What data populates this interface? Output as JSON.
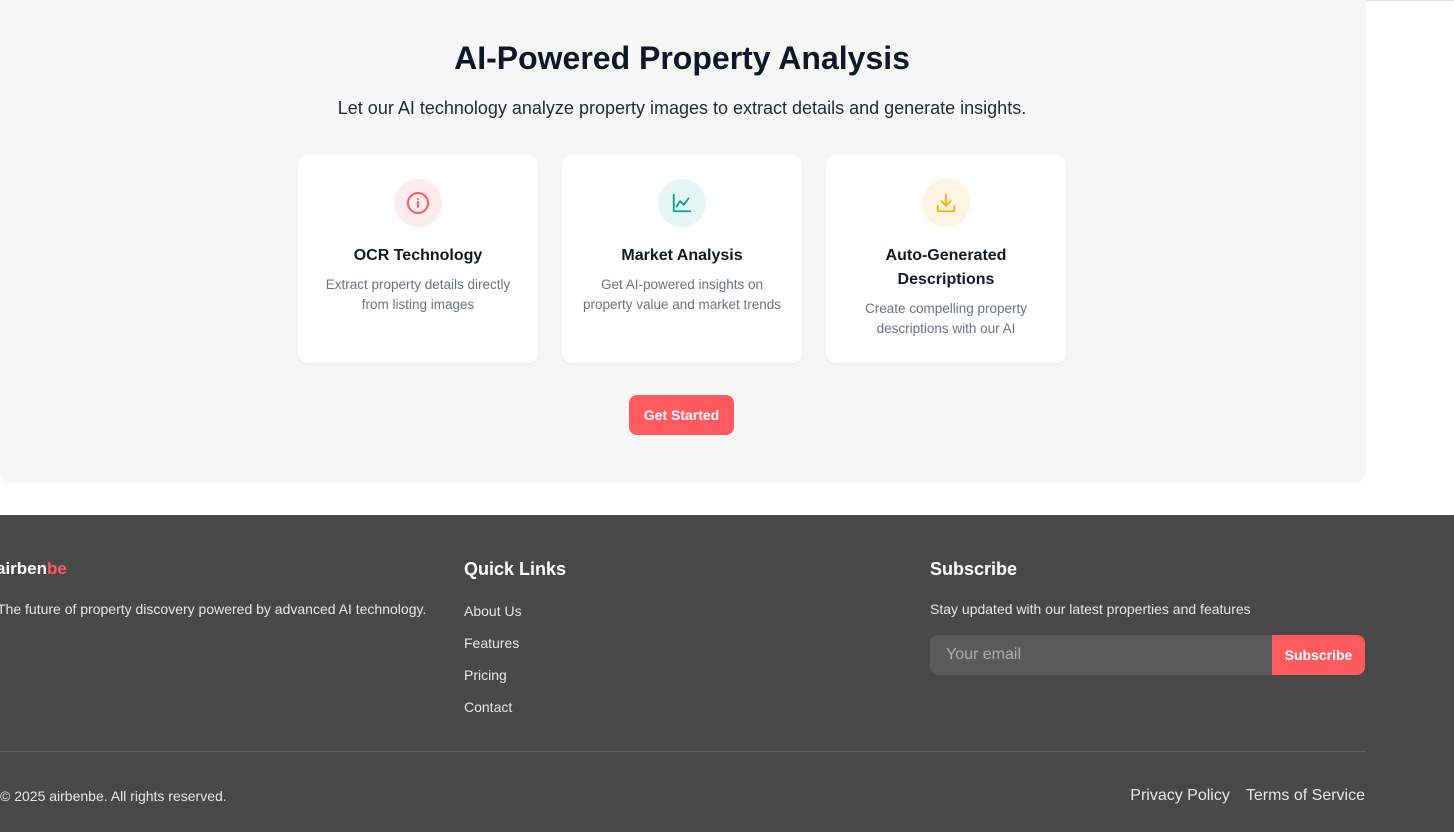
{
  "colors": {
    "accent": "#ff5a5f",
    "section_bg": "#f6f6f6",
    "footer_bg": "#484848",
    "ocr_icon_bg": "#fdecee",
    "ocr_icon": "#ff5a5f",
    "market_icon_bg": "#e6f6f4",
    "market_icon": "#0f9f95",
    "desc_icon_bg": "#fdf4e3",
    "desc_icon": "#f0b400"
  },
  "ai_section": {
    "title": "AI-Powered Property Analysis",
    "subtitle": "Let our AI technology analyze property images to extract details and generate insights.",
    "cards": [
      {
        "icon": "info-icon",
        "title": "OCR Technology",
        "description": "Extract property details directly from listing images"
      },
      {
        "icon": "chart-icon",
        "title": "Market Analysis",
        "description": "Get AI-powered insights on property value and market trends"
      },
      {
        "icon": "download-icon",
        "title": "Auto-Generated Descriptions",
        "description": "Create compelling property descriptions with our AI"
      }
    ],
    "cta_label": "Get Started"
  },
  "footer": {
    "brand_main": "airben",
    "brand_accent": "be",
    "tagline": "The future of property discovery powered by advanced AI technology.",
    "quick_links_title": "Quick Links",
    "quick_links": [
      "About Us",
      "Features",
      "Pricing",
      "Contact"
    ],
    "subscribe_title": "Subscribe",
    "subscribe_desc": "Stay updated with our latest properties and features",
    "email_placeholder": "Your email",
    "subscribe_button": "Subscribe",
    "copyright": "© 2025 airbenbe. All rights reserved.",
    "privacy": "Privacy Policy",
    "terms": "Terms of Service"
  }
}
